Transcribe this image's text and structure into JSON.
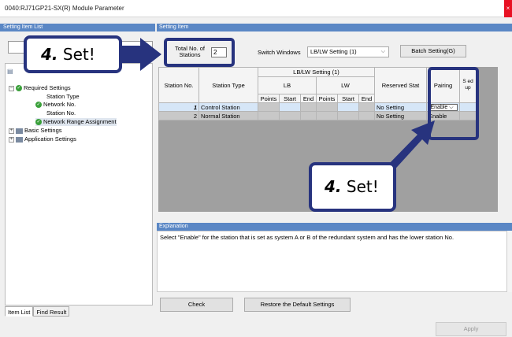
{
  "window": {
    "title": "0040:RJ71GP21-SX(R) Module Parameter",
    "close": "×"
  },
  "left_panel": {
    "header": "Setting Item List",
    "tree": [
      {
        "label": "Required Settings",
        "icon": "check-icon"
      },
      {
        "label": "Station Type"
      },
      {
        "label": "Network No.",
        "icon": "check-icon"
      },
      {
        "label": "Station No."
      },
      {
        "label": "Network Range Assignment",
        "icon": "check-icon"
      },
      {
        "label": "Basic Settings",
        "icon": "folder-icon"
      },
      {
        "label": "Application Settings",
        "icon": "folder-icon"
      }
    ],
    "tabs": [
      "Item List",
      "Find Result"
    ]
  },
  "right_panel": {
    "header": "Setting Item",
    "total_label_1": "Total No. of",
    "total_label_2": "Stations",
    "total_value": "2",
    "switch_label": "Switch Windows",
    "switch_value": "LB/LW Setting (1)",
    "batch_label": "Batch Setting(G)"
  },
  "grid": {
    "group_header": "LB/LW Setting (1)",
    "col_station_no": "Station No.",
    "col_station_type": "Station Type",
    "col_lb": "LB",
    "col_lw": "LW",
    "col_reserved": "Reserved Stat",
    "col_pairing": "Pairing",
    "col_speed": "S ed up",
    "sub_points": "Points",
    "sub_start": "Start",
    "sub_end": "End",
    "rows": [
      {
        "no": "1",
        "type": "Control Station",
        "reserved": "No Setting",
        "pairing": "Enable"
      },
      {
        "no": "2",
        "type": "Normal Station",
        "reserved": "No Setting",
        "pairing": "Enable"
      }
    ]
  },
  "explanation": {
    "header": "Explanation",
    "text": "Select \"Enable\" for the station that is set as system A or B of the redundant system and has the lower station No."
  },
  "buttons": {
    "check": "Check",
    "restore": "Restore the Default Settings",
    "apply": "Apply"
  },
  "callouts": {
    "step": "4.",
    "label": "Set!"
  }
}
